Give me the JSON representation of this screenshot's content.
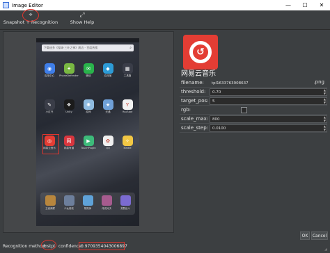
{
  "window": {
    "title": "Image Editor",
    "minimize": "—",
    "maximize": "☐",
    "close": "✕"
  },
  "toolbar": {
    "snapshot_label": "Snapshot + Recognition",
    "snapshot_icon": "crosshair-icon",
    "help_label": "Show Help",
    "help_icon": "expand-icon"
  },
  "phone": {
    "search_placeholder": "下载迪多《鬼城·三叶之神》周边 - 百度热搜",
    "apps": [
      {
        "label": "应用中心",
        "color": "#3f7ee8",
        "glyph": "◉"
      },
      {
        "label": "PhoneDefender",
        "color": "#79b842",
        "glyph": "✦"
      },
      {
        "label": "微信",
        "color": "#29b34b",
        "glyph": "✉"
      },
      {
        "label": "应用宝",
        "color": "#2d9bd6",
        "glyph": "◆"
      },
      {
        "label": "工具箱",
        "color": "#3a3d48",
        "glyph": "▦"
      },
      {
        "label": "小红书",
        "color": "#3a3d48",
        "glyph": "✎"
      },
      {
        "label": "Unity",
        "color": "#1b1b1b",
        "glyph": "❖"
      },
      {
        "label": "原神",
        "color": "#8fbbe0",
        "glyph": "✺"
      },
      {
        "label": "光遇",
        "color": "#6fa0d8",
        "glyph": "★"
      },
      {
        "label": "YouTube",
        "color": "#f2f2f2",
        "glyph": "Y"
      },
      {
        "label": "网易云音乐",
        "color": "#e33d34",
        "glyph": "◎"
      },
      {
        "label": "网易有道",
        "color": "#d9363e",
        "glyph": "网"
      },
      {
        "label": "TouchPlugin",
        "color": "#3dbb7a",
        "glyph": "▶"
      },
      {
        "label": "QQ",
        "color": "#f0f0f0",
        "glyph": "✿"
      },
      {
        "label": "Kindle",
        "color": "#f2c744",
        "glyph": "✧"
      }
    ],
    "dock": [
      {
        "label": "王者荣耀",
        "color": "#b8863d"
      },
      {
        "label": "少女前线",
        "color": "#6d7f9c"
      },
      {
        "label": "阴阳师",
        "color": "#5fa2d8"
      },
      {
        "label": "传说对决",
        "color": "#a65b8e"
      },
      {
        "label": "荒野乱斗",
        "color": "#7b6bd1"
      }
    ]
  },
  "preview": {
    "app_name": "网易云音乐",
    "icon": "netease-cloud-music-icon"
  },
  "props": {
    "filename": {
      "label": "filename:",
      "value": "tpl1633763908637",
      "ext": ".png"
    },
    "threshold": {
      "label": "threshold:",
      "value": "0.70"
    },
    "target_pos": {
      "label": "target_pos:",
      "value": "5"
    },
    "rgb": {
      "label": "rgb:"
    },
    "scale_max": {
      "label": "scale_max:",
      "value": "800"
    },
    "scale_step": {
      "label": "scale_step:",
      "value": "0.0100"
    }
  },
  "footer": {
    "method_label": "Recognition method:",
    "method_value": "mstpl",
    "confidence_label": "confidence:",
    "confidence_value": "0.9709354043006897"
  },
  "buttons": {
    "ok": "OK",
    "cancel": "Cancel"
  },
  "accent": "#e0362e"
}
